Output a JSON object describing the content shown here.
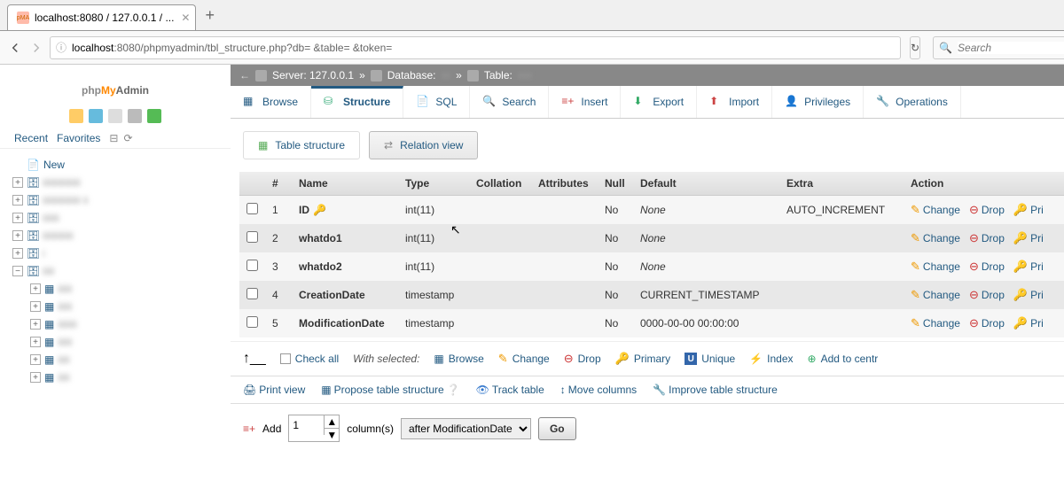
{
  "browser": {
    "tabTitle": "localhost:8080 / 127.0.0.1 / ...",
    "url_host": "localhost",
    "url_path": ":8080/phpmyadmin/tbl_structure.php?db=          &table=               &token=",
    "searchPlaceholder": "Search"
  },
  "logo": {
    "p1": "php",
    "p2": "My",
    "p3": "Admin"
  },
  "recentFav": {
    "recent": "Recent",
    "favorites": "Favorites"
  },
  "newLabel": "New",
  "breadcrumb": {
    "server": "Server: 127.0.0.1",
    "database": "Database:",
    "table": "Table:"
  },
  "tabs": {
    "browse": "Browse",
    "structure": "Structure",
    "sql": "SQL",
    "search": "Search",
    "insert": "Insert",
    "export": "Export",
    "import": "Import",
    "privileges": "Privileges",
    "operations": "Operations"
  },
  "subtabs": {
    "tablestructure": "Table structure",
    "relationview": "Relation view"
  },
  "columns": {
    "num": "#",
    "name": "Name",
    "type": "Type",
    "collation": "Collation",
    "attributes": "Attributes",
    "null": "Null",
    "default": "Default",
    "extra": "Extra",
    "action": "Action"
  },
  "rows": [
    {
      "n": "1",
      "name": "ID",
      "key": true,
      "type": "int(11)",
      "collation": "",
      "attr": "",
      "null": "No",
      "default": "None",
      "defitalic": true,
      "extra": "AUTO_INCREMENT"
    },
    {
      "n": "2",
      "name": "whatdo1",
      "key": false,
      "type": "int(11)",
      "collation": "",
      "attr": "",
      "null": "No",
      "default": "None",
      "defitalic": true,
      "extra": ""
    },
    {
      "n": "3",
      "name": "whatdo2",
      "key": false,
      "type": "int(11)",
      "collation": "",
      "attr": "",
      "null": "No",
      "default": "None",
      "defitalic": true,
      "extra": ""
    },
    {
      "n": "4",
      "name": "CreationDate",
      "key": false,
      "type": "timestamp",
      "collation": "",
      "attr": "",
      "null": "No",
      "default": "CURRENT_TIMESTAMP",
      "defitalic": false,
      "extra": ""
    },
    {
      "n": "5",
      "name": "ModificationDate",
      "key": false,
      "type": "timestamp",
      "collation": "",
      "attr": "",
      "null": "No",
      "default": "0000-00-00 00:00:00",
      "defitalic": false,
      "extra": ""
    }
  ],
  "rowActions": {
    "change": "Change",
    "drop": "Drop",
    "pri": "Pri"
  },
  "toolbar": {
    "checkall": "Check all",
    "withselected": "With selected:",
    "browse": "Browse",
    "change": "Change",
    "drop": "Drop",
    "primary": "Primary",
    "unique": "Unique",
    "index": "Index",
    "addtocentre": "Add to centr"
  },
  "toolbar2": {
    "print": "Print view",
    "propose": "Propose table structure",
    "track": "Track table",
    "move": "Move columns",
    "improve": "Improve table structure"
  },
  "addrow": {
    "add": "Add",
    "value": "1",
    "columns": "column(s)",
    "selectopt": "after ModificationDate",
    "go": "Go"
  }
}
